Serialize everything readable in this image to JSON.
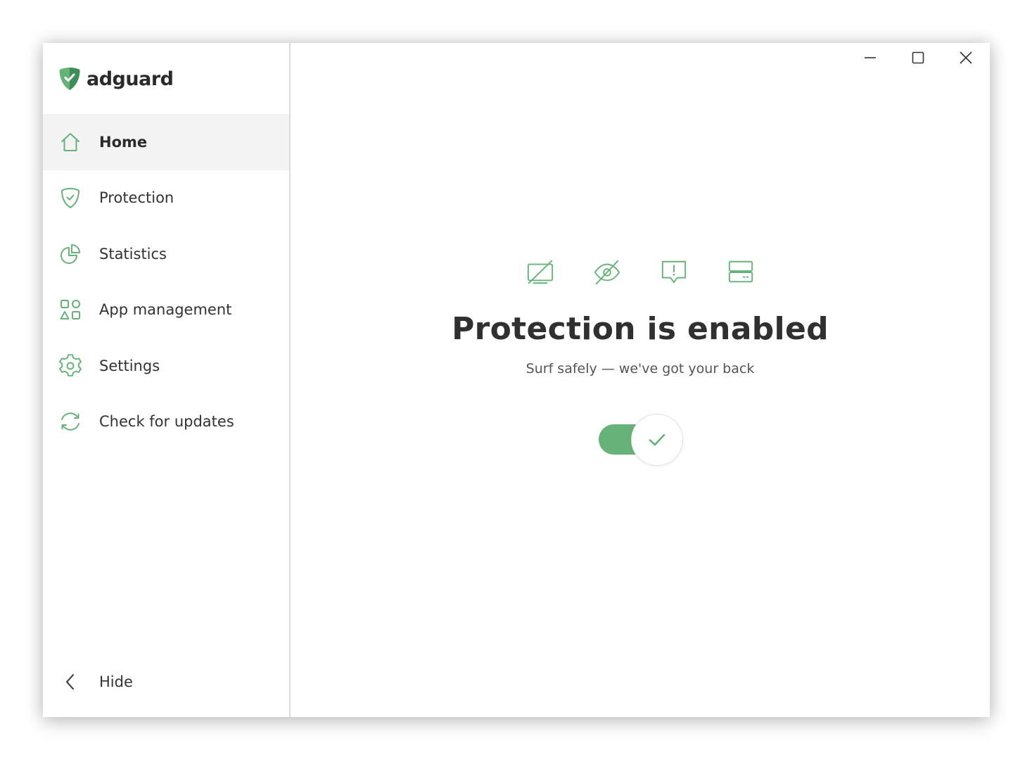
{
  "app": {
    "brand": "adguard",
    "accent_color": "#67b279"
  },
  "sidebar": {
    "items": [
      {
        "label": "Home",
        "icon": "home-icon",
        "active": true
      },
      {
        "label": "Protection",
        "icon": "shield-check-icon",
        "active": false
      },
      {
        "label": "Statistics",
        "icon": "pie-chart-icon",
        "active": false
      },
      {
        "label": "App management",
        "icon": "apps-grid-icon",
        "active": false
      },
      {
        "label": "Settings",
        "icon": "gear-icon",
        "active": false
      },
      {
        "label": "Check for updates",
        "icon": "refresh-icon",
        "active": false
      }
    ],
    "hide_label": "Hide"
  },
  "window_controls": {
    "icons": [
      "minimize-icon",
      "maximize-icon",
      "close-icon"
    ]
  },
  "main": {
    "feature_icons": [
      "ad-block-icon",
      "tracking-protection-icon",
      "annoyance-block-icon",
      "dns-filter-icon"
    ],
    "title": "Protection is enabled",
    "subtitle": "Surf safely — we've got your back",
    "protection_toggle": {
      "on": true
    }
  }
}
